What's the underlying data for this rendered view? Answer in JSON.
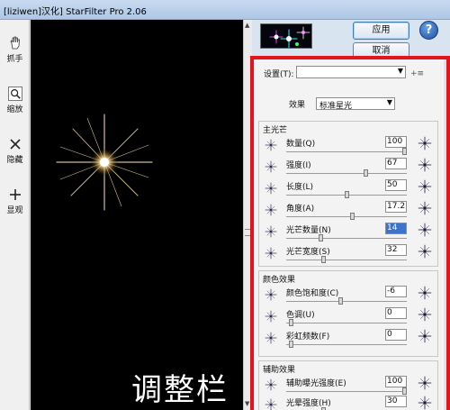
{
  "window": {
    "title": "[liziwen]汉化] StarFilter Pro 2.06"
  },
  "toolbar": {
    "items": [
      {
        "label": "抓手",
        "icon": "hand-icon"
      },
      {
        "label": "缩放",
        "icon": "zoom-icon"
      },
      {
        "label": "隐藏",
        "icon": "hide-icon"
      },
      {
        "label": "显观",
        "icon": "show-icon"
      }
    ]
  },
  "preview": {
    "overlay_text": "调整栏"
  },
  "buttons": {
    "apply": "应用",
    "cancel": "取消",
    "help": "?"
  },
  "settings": {
    "preset_label": "设置(T):",
    "preset_value": "",
    "add_symbol": "+≡",
    "effect_label": "效果",
    "effect_value": "标准星光"
  },
  "groups": [
    {
      "title": "主光芒",
      "rows": [
        {
          "label": "数量(Q)",
          "value": "100",
          "level": 1.0
        },
        {
          "label": "强度(I)",
          "value": "67",
          "level": 0.67
        },
        {
          "label": "长度(L)",
          "value": "50",
          "level": 0.5
        },
        {
          "label": "角度(A)",
          "value": "17.2",
          "level": 0.55
        },
        {
          "label": "光芒数量(N)",
          "value": "14",
          "level": 0.28,
          "highlighted": true
        },
        {
          "label": "光芒宽度(S)",
          "value": "32",
          "level": 0.3
        }
      ]
    },
    {
      "title": "颜色效果",
      "rows": [
        {
          "label": "颜色饱和度(C)",
          "value": "-6",
          "level": 0.45
        },
        {
          "label": "色调(U)",
          "value": "0",
          "level": 0.02
        },
        {
          "label": "彩虹频数(F)",
          "value": "0",
          "level": 0.02
        }
      ]
    },
    {
      "title": "辅助效果",
      "rows": [
        {
          "label": "辅助曝光强度(E)",
          "value": "100",
          "level": 1.0
        },
        {
          "label": "光晕强度(H)",
          "value": "30",
          "level": 0.3
        }
      ]
    }
  ],
  "colors": {
    "highlight_frame": "#e2151d",
    "selection": "#3d73c9",
    "preview_bg": "#000000"
  }
}
